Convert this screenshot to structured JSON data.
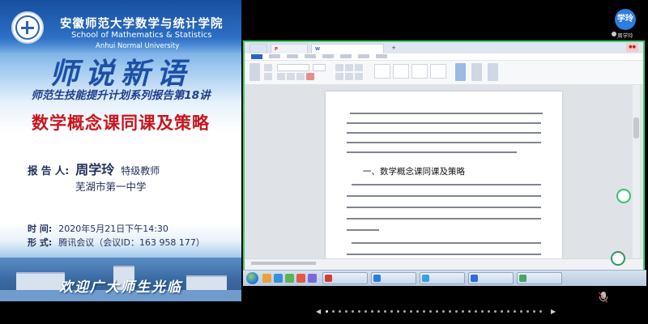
{
  "poster": {
    "school_cn": "安徽师范大学数学与统计学院",
    "school_en_1": "School of Mathematics & Statistics",
    "school_en_2": "Anhui Normal University",
    "big_title": "师说新语",
    "subtitle": "师范生技能提升计划系列报告第18讲",
    "topic": "数学概念课同课及策略",
    "speaker_label": "报 告 人:",
    "speaker_name": "周学玲",
    "speaker_title": "特级教师",
    "organization": "芜湖市第一中学",
    "time_label": "时  间:",
    "time_value": "2020年5月21日下午14:30",
    "format_label": "形  式:",
    "format_value": "腾讯会议（会议ID：163 958 177）",
    "welcome": "欢迎广大师生光临"
  },
  "document": {
    "heading": "一、数学概念课同课及策略"
  },
  "avatar": {
    "text": "学玲",
    "caption": "周学玲"
  },
  "colors": {
    "share_border": "#3bd16f",
    "topic_red": "#c7161e",
    "title_blue": "#1d4fa6",
    "taskbar": "#c4d4e6"
  },
  "icons": [
    "logo-icon",
    "start-icon",
    "microphone-muted-icon",
    "page-prev-icon",
    "page-next-icon"
  ]
}
